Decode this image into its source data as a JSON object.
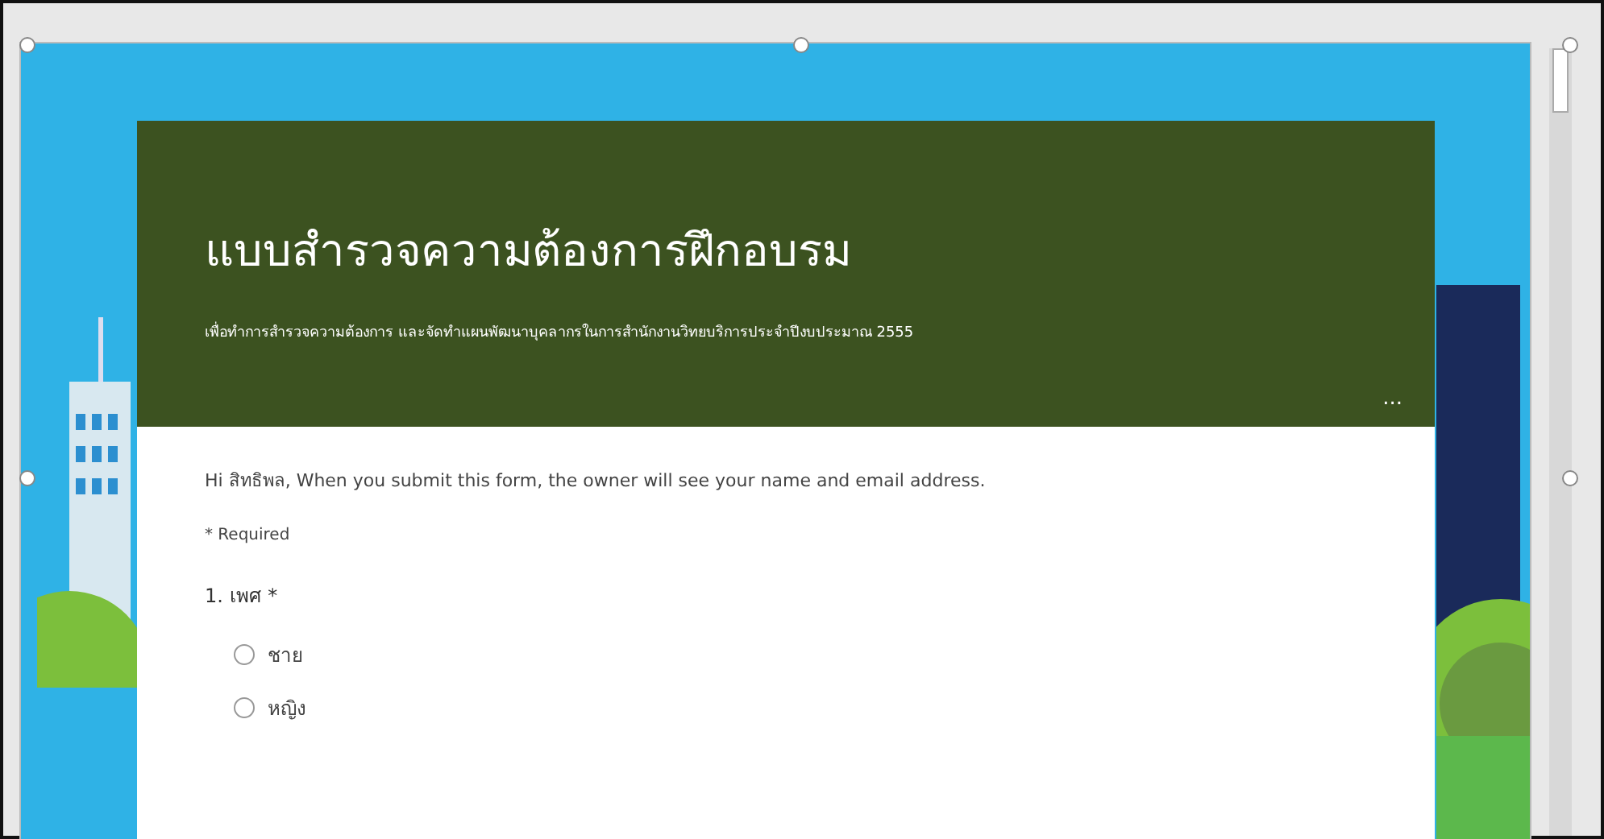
{
  "form": {
    "title": "แบบสำรวจความต้องการฝึกอบรม",
    "description": "เพื่อทำการสำรวจความต้องการ และจัดทำแผนพัฒนาบุคลากรในการสำนักงานวิทยบริการประจำปีงบประมาณ 2555",
    "more_button": "...",
    "notice": "Hi สิทธิพล, When you submit this form, the owner will see your name and email address.",
    "required_note": "* Required",
    "questions": [
      {
        "label": "1. เพศ *",
        "kind": "radio",
        "options": [
          {
            "label": "ชาย",
            "selected": false
          },
          {
            "label": "หญิง",
            "selected": false
          }
        ]
      }
    ]
  }
}
